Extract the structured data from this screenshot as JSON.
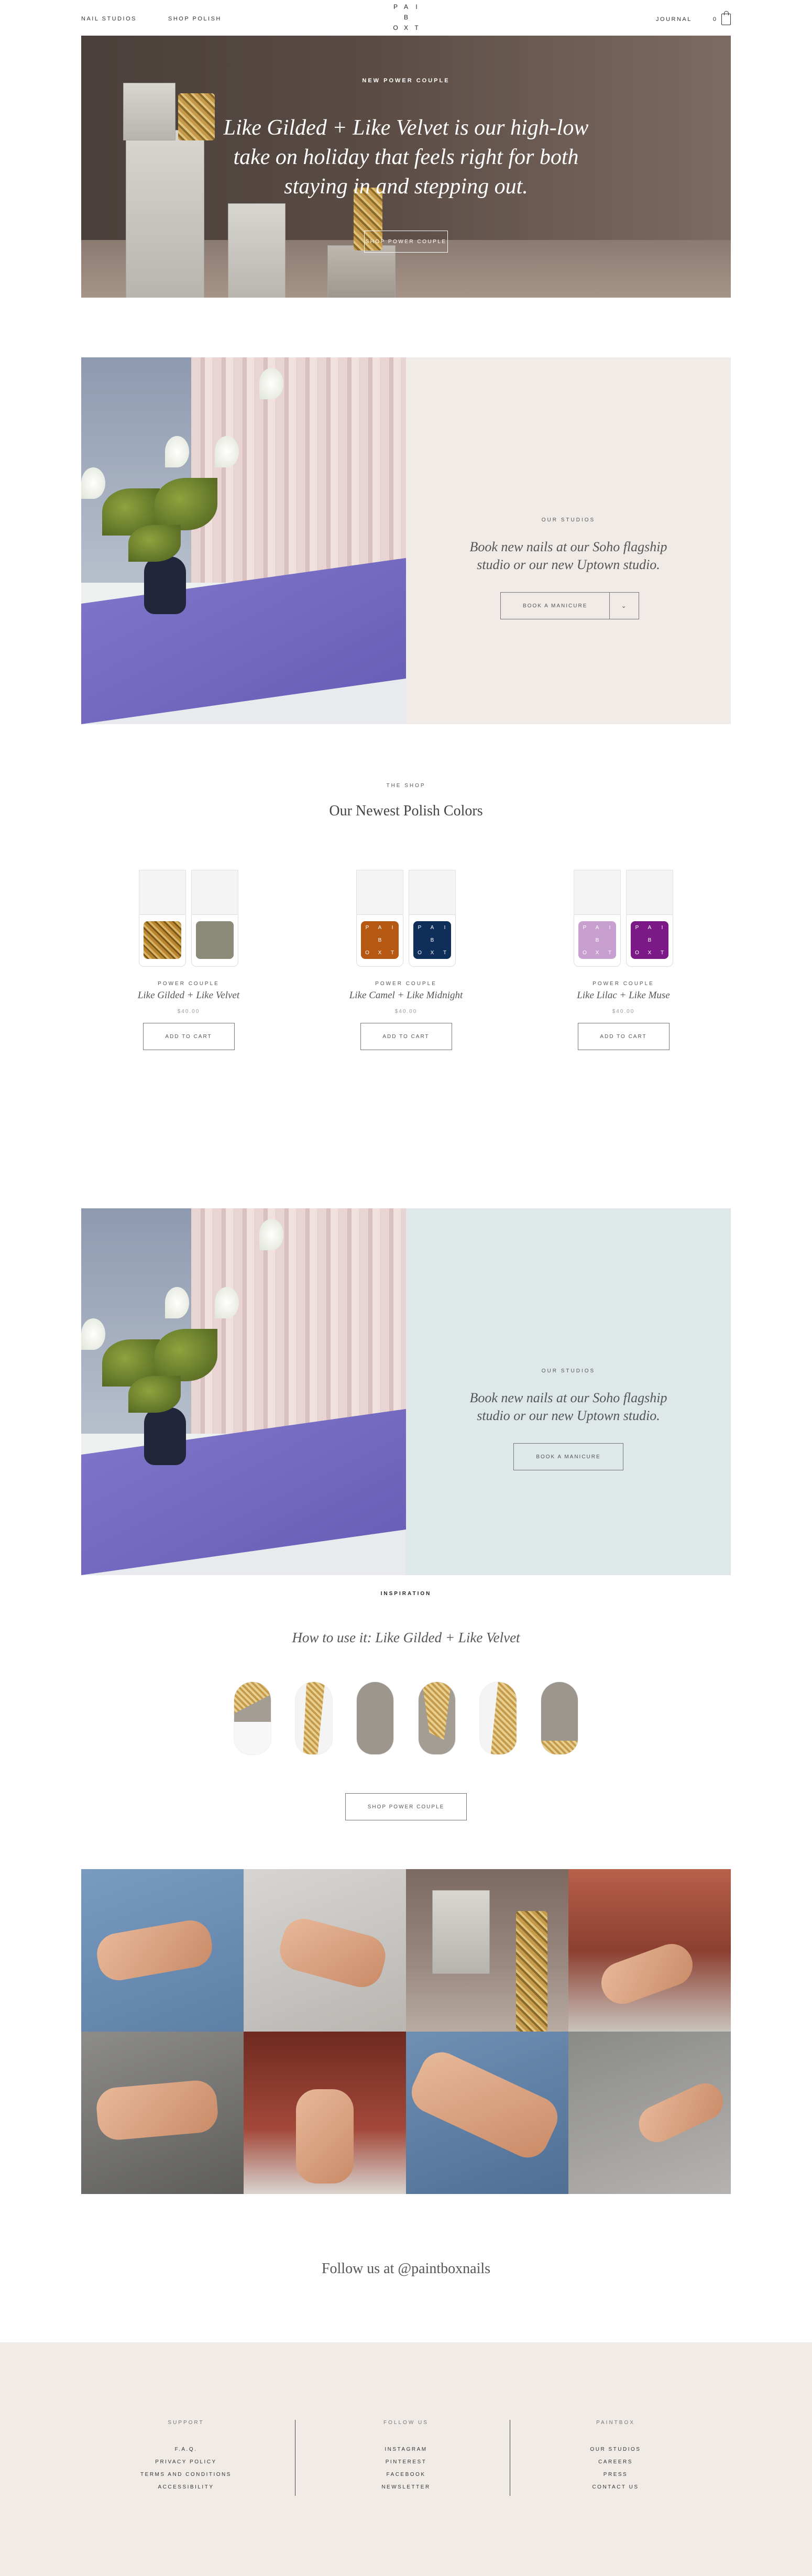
{
  "header": {
    "nav_left": [
      "NAIL STUDIOS",
      "SHOP POLISH"
    ],
    "logo_letters": [
      "P",
      "A",
      "I",
      "",
      "B",
      "",
      "O",
      "X",
      "T"
    ],
    "journal": "JOURNAL",
    "cart_count": "0"
  },
  "hero": {
    "eyebrow": "NEW POWER COUPLE",
    "title": "Like Gilded + Like Velvet is our high-low take on holiday that feels right for both staying in and stepping out.",
    "button": "SHOP POWER COUPLE"
  },
  "studio_1": {
    "eyebrow": "OUR STUDIOS",
    "text": "Book new nails at our Soho flagship studio or our new Uptown studio.",
    "button": "BOOK A MANICURE",
    "caret": "⌄",
    "bg": "#f0ebe6"
  },
  "shop": {
    "eyebrow": "THE SHOP",
    "title": "Our Newest Polish Colors",
    "products": [
      {
        "category": "POWER COUPLE",
        "name": "Like Gilded + Like Velvet",
        "price": "$40.00",
        "button": "ADD TO CART",
        "colors": [
          "#b8862e",
          "#8c8a78"
        ]
      },
      {
        "category": "POWER COUPLE",
        "name": "Like Camel + Like Midnight",
        "price": "$40.00",
        "button": "ADD TO CART",
        "colors": [
          "#b55812",
          "#0f2e5a"
        ]
      },
      {
        "category": "POWER COUPLE",
        "name": "Like Lilac + Like Muse",
        "price": "$40.00",
        "button": "ADD TO CART",
        "colors": [
          "#c7a0cf",
          "#7b1a86"
        ]
      }
    ],
    "bottle_logo": [
      "P",
      "A",
      "I",
      "B",
      "O",
      "X",
      "T"
    ]
  },
  "studio_2": {
    "eyebrow": "OUR STUDIOS",
    "text": "Book new nails at our Soho flagship studio or our new Uptown studio.",
    "button": "BOOK A MANICURE",
    "bg": "#dfe8e8"
  },
  "inspiration": {
    "eyebrow": "INSPIRATION",
    "title": "How to use it: Like Gilded + Like Velvet",
    "button": "SHOP POWER COUPLE"
  },
  "follow": "Follow us at @paintboxnails",
  "footer": {
    "columns": [
      {
        "heading": "SUPPORT",
        "links": [
          "F.A.Q.",
          "PRIVACY POLICY",
          "TERMS AND CONDITIONS",
          "ACCESSIBILITY"
        ]
      },
      {
        "heading": "FOLLOW US",
        "links": [
          "INSTAGRAM",
          "PINTEREST",
          "FACEBOOK",
          "NEWSLETTER"
        ]
      },
      {
        "heading": "PAINTBOX",
        "links": [
          "OUR STUDIOS",
          "CAREERS",
          "PRESS",
          "CONTACT US"
        ]
      }
    ]
  }
}
